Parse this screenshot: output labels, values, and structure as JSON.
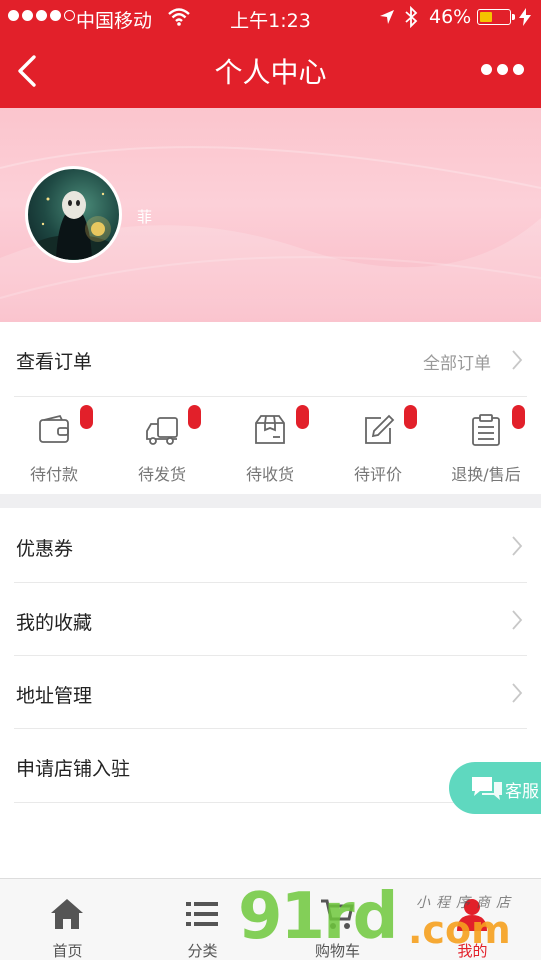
{
  "status_bar": {
    "carrier": "中国移动",
    "time": "上午1:23",
    "battery": "46%",
    "battery_level": 0.46
  },
  "nav": {
    "title": "个人中心",
    "back_icon": "chevron-left-icon",
    "more_icon": "more-dots-icon"
  },
  "profile": {
    "username": "菲"
  },
  "orders": {
    "title": "查看订单",
    "all_label": "全部订单",
    "statuses": [
      {
        "label": "待付款",
        "icon": "wallet-icon"
      },
      {
        "label": "待发货",
        "icon": "truck-icon"
      },
      {
        "label": "待收货",
        "icon": "package-icon"
      },
      {
        "label": "待评价",
        "icon": "edit-icon"
      },
      {
        "label": "退换/售后",
        "icon": "clipboard-icon"
      }
    ]
  },
  "menu": [
    {
      "label": "优惠券"
    },
    {
      "label": "我的收藏"
    },
    {
      "label": "地址管理"
    },
    {
      "label": "申请店铺入驻"
    }
  ],
  "customer_service": {
    "label": "客服"
  },
  "tabbar": [
    {
      "label": "首页",
      "icon": "home-icon"
    },
    {
      "label": "分类",
      "icon": "category-list-icon"
    },
    {
      "label": "购物车",
      "icon": "cart-icon"
    },
    {
      "label": "我的",
      "icon": "user-icon",
      "active": true
    }
  ],
  "watermark": {
    "brand": "91rd",
    "domain": ".com",
    "tagline": "小程序商店"
  },
  "colors": {
    "accent": "#e2202a",
    "profile_bg": "#fcd0d8",
    "kefu": "#5fd8bf"
  }
}
